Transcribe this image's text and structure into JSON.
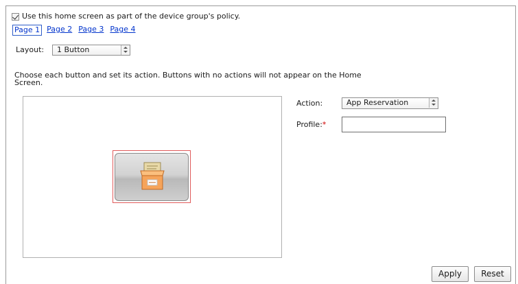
{
  "policy": {
    "checked": true,
    "label": "Use this home screen as part of the device group's policy."
  },
  "pages": [
    {
      "label": "Page 1",
      "active": true
    },
    {
      "label": "Page 2",
      "active": false
    },
    {
      "label": "Page 3",
      "active": false
    },
    {
      "label": "Page 4",
      "active": false
    }
  ],
  "layout": {
    "label": "Layout:",
    "selected": "1 Button"
  },
  "instructions": "Choose each button and set its action. Buttons with no actions will not appear on the Home Screen.",
  "home_button": {
    "icon": "app-reservation-box-icon",
    "selected_border_color": "#e05a5a",
    "icon_color": "#f6a45a"
  },
  "action": {
    "label": "Action:",
    "selected": "App Reservation"
  },
  "profile": {
    "label": "Profile:",
    "required_mark": "*",
    "value": ""
  },
  "buttons": {
    "apply": "Apply",
    "reset": "Reset"
  }
}
